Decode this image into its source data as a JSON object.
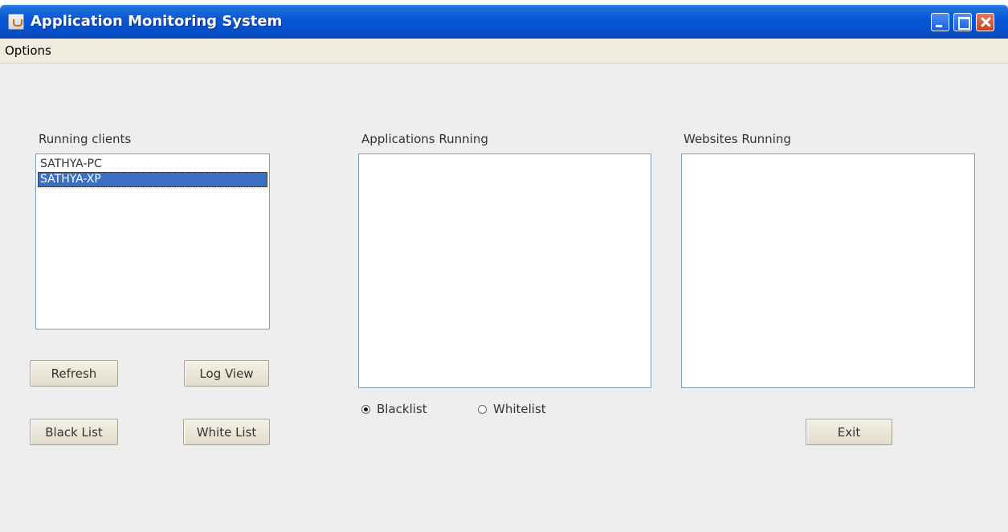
{
  "window": {
    "title": "Application Monitoring System"
  },
  "menu": {
    "items": [
      "Options"
    ]
  },
  "clients": {
    "label": "Running clients",
    "items": [
      "SATHYA-PC",
      "SATHYA-XP"
    ],
    "selected": "SATHYA-XP"
  },
  "applications": {
    "label": "Applications Running",
    "items": []
  },
  "websites": {
    "label": "Websites Running",
    "items": []
  },
  "buttons": {
    "refresh": "Refresh",
    "log_view": "Log View",
    "black_list": "Black List",
    "white_list": "White List",
    "exit": "Exit"
  },
  "list_mode": {
    "options": [
      "Blacklist",
      "Whitelist"
    ],
    "selected": "Blacklist"
  },
  "colors": {
    "titlebar": "#0a58d6",
    "selection": "#3a6fc4",
    "background": "#eeeeee",
    "close_button": "#c9431d"
  },
  "icons": {
    "app": "java-cup-icon",
    "minimize": "minimize-icon",
    "maximize": "maximize-icon",
    "close": "close-icon"
  }
}
